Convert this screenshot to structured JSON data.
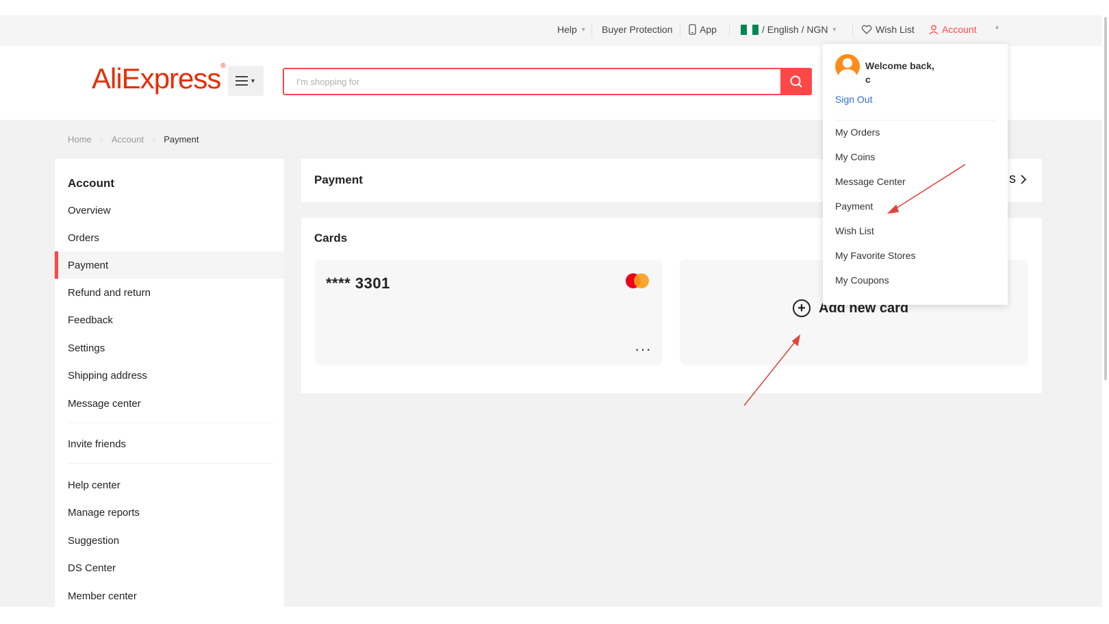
{
  "topbar": {
    "help": "Help",
    "buyer_protection": "Buyer Protection",
    "app": "App",
    "language": "/ English / NGN",
    "wish_list": "Wish List",
    "account": "Account"
  },
  "header": {
    "logo": "AliExpress",
    "search_placeholder": "I'm shopping for"
  },
  "breadcrumb": {
    "home": "Home",
    "account": "Account",
    "current": "Payment"
  },
  "sidebar": {
    "title": "Account",
    "items": [
      {
        "label": "Overview"
      },
      {
        "label": "Orders"
      },
      {
        "label": "Payment",
        "active": true
      },
      {
        "label": "Refund and return"
      },
      {
        "label": "Feedback"
      },
      {
        "label": "Settings"
      },
      {
        "label": "Shipping address"
      },
      {
        "label": "Message center"
      },
      {
        "label": "Invite friends"
      },
      {
        "label": "Help center"
      },
      {
        "label": "Manage reports"
      },
      {
        "label": "Suggestion"
      },
      {
        "label": "DS Center"
      },
      {
        "label": "Member center"
      }
    ]
  },
  "payment": {
    "title": "Payment",
    "header_right_text": "s",
    "cards_title": "Cards",
    "card_number": "**** 3301",
    "card_brand_icon": "mastercard-icon",
    "add_card_label": "Add new card"
  },
  "dropdown": {
    "welcome": "Welcome back,",
    "username": "c",
    "sign_out": "Sign Out",
    "items": [
      {
        "label": "My Orders"
      },
      {
        "label": "My Coins"
      },
      {
        "label": "Message Center"
      },
      {
        "label": "Payment"
      },
      {
        "label": "Wish List"
      },
      {
        "label": "My Favorite Stores"
      },
      {
        "label": "My Coupons"
      }
    ]
  },
  "colors": {
    "accent": "#ff4747",
    "logo": "#e62e04",
    "link": "#2f6fd6",
    "annotation_arrow": "#e0443c"
  }
}
